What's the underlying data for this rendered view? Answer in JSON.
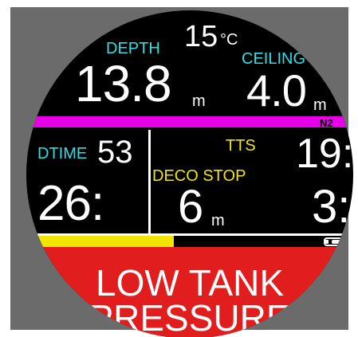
{
  "colors": {
    "bezel": "#6b6b6b",
    "screen_bg": "#000000",
    "label_cyan": "#2de0e8",
    "label_yellow": "#f2e600",
    "gas_bar_magenta": "#e800e8",
    "progress_yellow": "#f2e600",
    "alarm_red": "#e11d1d",
    "value_white": "#ffffff"
  },
  "top": {
    "temperature_value": "15",
    "temperature_unit": "°C",
    "depth_label": "DEPTH",
    "depth_value": "13.8",
    "depth_unit": "m",
    "ceiling_label": "CEILING",
    "ceiling_value": "4.0",
    "ceiling_unit": "m"
  },
  "gas_bar": {
    "gas_label": "N2"
  },
  "left_panel": {
    "dtime_label": "DTIME",
    "dtime_value": "53",
    "elapsed_value": "26:"
  },
  "right_panel": {
    "tts_label": "TTS",
    "tts_value": "19:",
    "deco_stop_label": "DECO STOP",
    "deco_stop_depth": "6",
    "deco_stop_unit": "m",
    "deco_stop_time": "3:"
  },
  "progress": {
    "fill_fraction": 0.45
  },
  "icons": {
    "battery": "battery-icon"
  },
  "alarm": {
    "line1": "LOW TANK",
    "line2": "PRESSURE"
  }
}
